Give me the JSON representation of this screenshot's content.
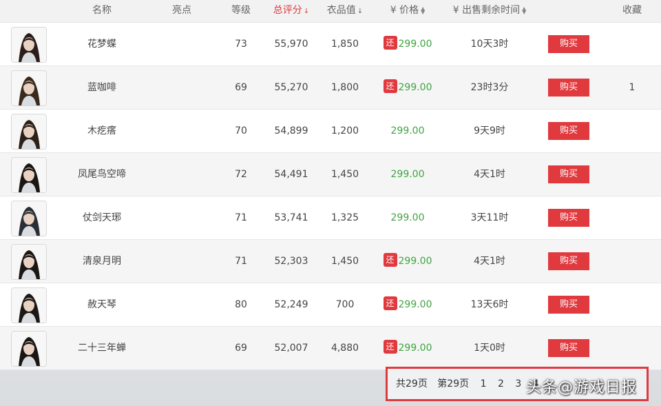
{
  "header": {
    "name": "名称",
    "highlight": "亮点",
    "level": "等级",
    "score": "总评分",
    "score_sort": "↓",
    "clothing": "衣品值",
    "clothing_sort": "↓",
    "price": "¥ 价格",
    "time_left": "¥ 出售剩余时间",
    "favorite": "收藏"
  },
  "colors": {
    "accent": "#e0393e",
    "price_green": "#3fa33f"
  },
  "rebate_label": "还",
  "buy_label": "购买",
  "rows": [
    {
      "name": "花梦蝶",
      "level": "73",
      "score": "55,970",
      "clothing": "1,850",
      "rebate": true,
      "price": "299.00",
      "time": "10天3时",
      "fav": ""
    },
    {
      "name": "蓝咖啡",
      "level": "69",
      "score": "55,270",
      "clothing": "1,800",
      "rebate": true,
      "price": "299.00",
      "time": "23时3分",
      "fav": "1"
    },
    {
      "name": "木疙瘩",
      "level": "70",
      "score": "54,899",
      "clothing": "1,200",
      "rebate": false,
      "price": "299.00",
      "time": "9天9时",
      "fav": ""
    },
    {
      "name": "凤尾鸟空啼",
      "level": "72",
      "score": "54,491",
      "clothing": "1,450",
      "rebate": false,
      "price": "299.00",
      "time": "4天1时",
      "fav": ""
    },
    {
      "name": "仗剑天琊",
      "level": "71",
      "score": "53,741",
      "clothing": "1,325",
      "rebate": false,
      "price": "299.00",
      "time": "3天11时",
      "fav": ""
    },
    {
      "name": "清泉月明",
      "level": "71",
      "score": "52,303",
      "clothing": "1,450",
      "rebate": true,
      "price": "299.00",
      "time": "4天1时",
      "fav": ""
    },
    {
      "name": "赦天琴",
      "level": "80",
      "score": "52,249",
      "clothing": "700",
      "rebate": true,
      "price": "299.00",
      "time": "13天6时",
      "fav": ""
    },
    {
      "name": "二十三年蝉",
      "level": "69",
      "score": "52,007",
      "clothing": "4,880",
      "rebate": true,
      "price": "299.00",
      "time": "1天0时",
      "fav": ""
    }
  ],
  "pagination": {
    "total": "共29页",
    "current": "第29页",
    "pages": [
      "1",
      "2",
      "3",
      "4"
    ]
  },
  "watermark": "头条@游戏日报"
}
